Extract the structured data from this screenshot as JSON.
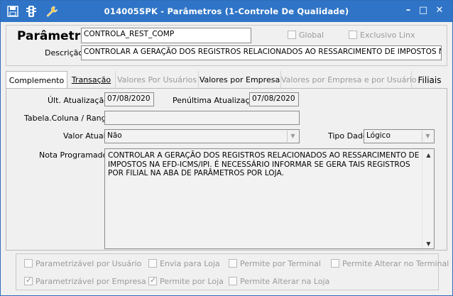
{
  "titlebar": {
    "title": "014005SPK - Parâmetros (1-Controle De Qualidade)",
    "left_icons": [
      "save-icon",
      "traffic-light-icon",
      "wrench-icon"
    ],
    "minimize": "–",
    "maximize": "□",
    "close": "✕"
  },
  "header": {
    "param_label": "Parâmetro",
    "param_value": "CONTROLA_REST_COMP",
    "global_label": "Global",
    "exclusivo_label": "Exclusivo Linx",
    "descricao_label": "Descrição",
    "descricao_value": "CONTROLAR A GERAÇÃO DOS REGISTROS RELACIONADOS AO RESSARCIMENTO DE IMPOSTOS NA EFD"
  },
  "tabs": [
    {
      "label": "Complemento",
      "state": "active"
    },
    {
      "label": "Transação",
      "state": "normal"
    },
    {
      "label": "Valores Por Usuários",
      "state": "disabled"
    },
    {
      "label": "Valores por Empresa",
      "state": "normal"
    },
    {
      "label": "Valores por Empresa e por Usuário",
      "state": "disabled"
    },
    {
      "label": "Filiais",
      "state": "normal"
    }
  ],
  "complemento": {
    "ult_atualizacao_label": "Últ. Atualização",
    "ult_atualizacao_value": "07/08/2020",
    "penultima_label": "Penúltima Atualização",
    "penultima_value": "07/08/2020",
    "tabela_label": "Tabela.Coluna / Range",
    "tabela_value": "",
    "valor_atual_label": "Valor Atual",
    "valor_atual_value": "Não",
    "tipo_dado_label": "Tipo Dado",
    "tipo_dado_value": "Lógico",
    "nota_label": "Nota Programador",
    "nota_value": "CONTROLAR A GERAÇÃO DOS REGISTROS RELACIONADOS AO RESSARCIMENTO DE IMPOSTOS NA EFD-ICMS/IPI. É NECESSÁRIO INFORMAR SE GERA TAIS REGISTROS POR FILIAL NA ABA DE PARÂMETROS POR LOJA."
  },
  "flags": [
    {
      "label": "Parametrizável por Usuário",
      "checked": false
    },
    {
      "label": "Envia para Loja",
      "checked": false
    },
    {
      "label": "Permite por Terminal",
      "checked": false
    },
    {
      "label": "Permite Alterar no Terminal",
      "checked": false
    },
    {
      "label": "Parametrizável por Empresa",
      "checked": true
    },
    {
      "label": "Permite por Loja",
      "checked": true
    },
    {
      "label": "Permite Alterar na Loja",
      "checked": false
    }
  ],
  "colors": {
    "titlebar": "#2f74c7",
    "window_bg": "#f0f0f0",
    "field_bg": "#f2f2f2",
    "disabled_text": "#9a9a9a"
  }
}
